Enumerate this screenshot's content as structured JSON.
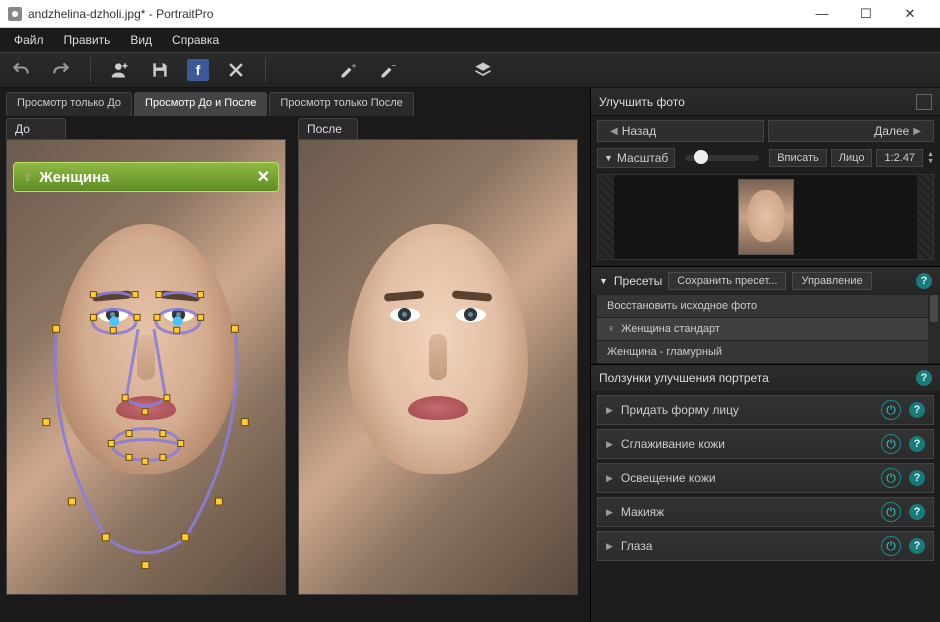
{
  "window": {
    "title": "andzhelina-dzholi.jpg* - PortraitPro"
  },
  "menu": {
    "file": "Файл",
    "edit": "Править",
    "view": "Вид",
    "help": "Справка"
  },
  "toolbar": {
    "undo": "undo",
    "redo": "redo",
    "addperson": "add-person",
    "save": "save",
    "facebook": "f",
    "close": "close",
    "brush_add": "brush-plus",
    "brush_remove": "brush-minus",
    "layers": "layers"
  },
  "viewTabs": {
    "before_only": "Просмотр только До",
    "both": "Просмотр До и После",
    "after_only": "Просмотр только После",
    "active": "both"
  },
  "views": {
    "before": "До",
    "after": "После"
  },
  "gender_tag": {
    "label": "Женщина",
    "symbol": "♀",
    "close": "✕"
  },
  "side": {
    "title": "Улучшить фото",
    "nav": {
      "back": "Назад",
      "next": "Далее"
    },
    "zoom": {
      "label": "Масштаб",
      "fit": "Вписать",
      "face": "Лицо",
      "ratio": "1:2.47"
    },
    "presets": {
      "header": "Пресеты",
      "save_preset": "Сохранить пресет...",
      "manage": "Управление",
      "items": [
        {
          "label": "Восстановить исходное фото",
          "female": false
        },
        {
          "label": "Женщина стандарт",
          "female": true,
          "selected": true
        },
        {
          "label": "Женщина - гламурный",
          "female": false
        }
      ]
    },
    "sliders": {
      "header": "Ползунки улучшения портрета",
      "items": [
        {
          "label": "Придать форму лицу"
        },
        {
          "label": "Сглаживание кожи"
        },
        {
          "label": "Освещение кожи"
        },
        {
          "label": "Макияж"
        },
        {
          "label": "Глаза"
        }
      ]
    }
  }
}
